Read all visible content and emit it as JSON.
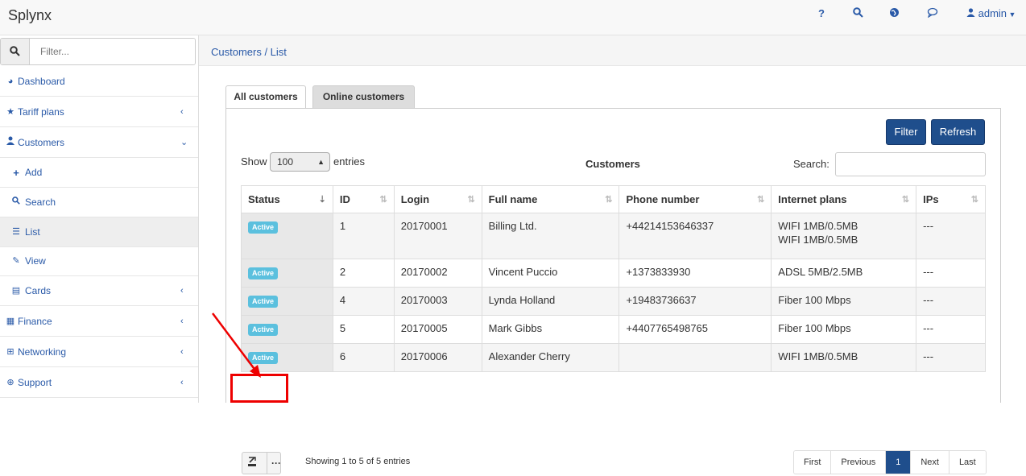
{
  "app": {
    "brand": "Splynx",
    "user_label": "admin"
  },
  "topbar_icons": [
    "help-icon",
    "search-icon",
    "globe-icon",
    "chat-icon",
    "user-icon"
  ],
  "topbar_help": "?",
  "sidebar": {
    "filter_placeholder": "Filter...",
    "items": [
      {
        "label": "Dashboard",
        "icon": "dashboard-icon"
      },
      {
        "label": "Tariff plans",
        "icon": "star-icon"
      },
      {
        "label": "Customers",
        "icon": "user-icon"
      },
      {
        "label": "Add",
        "icon": "plus-icon"
      },
      {
        "label": "Search",
        "icon": "search-icon"
      },
      {
        "label": "List",
        "icon": "list-icon"
      },
      {
        "label": "View",
        "icon": "pencil-icon"
      },
      {
        "label": "Cards",
        "icon": "cards-icon"
      },
      {
        "label": "Finance",
        "icon": "calculator-icon"
      },
      {
        "label": "Networking",
        "icon": "sitemap-icon"
      },
      {
        "label": "Support",
        "icon": "lifebuoy-icon"
      }
    ]
  },
  "breadcrumb": "Customers / List",
  "tabs": [
    "All customers",
    "Online customers"
  ],
  "buttons": {
    "filter": "Filter",
    "refresh": "Refresh"
  },
  "controls": {
    "show_label": "Show",
    "show_value": "100",
    "entries_label": "entries",
    "table_caption": "Customers",
    "search_label": "Search:"
  },
  "table": {
    "columns": [
      "Status",
      "ID",
      "Login",
      "Full name",
      "Phone number",
      "Internet plans",
      "IPs"
    ],
    "rows": [
      {
        "status": "Active",
        "id": "1",
        "login": "20170001",
        "name": "Billing Ltd.",
        "phone": "+44214153646337",
        "plans": "WIFI 1MB/0.5MB",
        "plans2": "WIFI 1MB/0.5MB",
        "ips": "---"
      },
      {
        "status": "Active",
        "id": "2",
        "login": "20170002",
        "name": "Vincent Puccio",
        "phone": "+1373833930",
        "plans": "ADSL 5MB/2.5MB",
        "plans2": "",
        "ips": "---"
      },
      {
        "status": "Active",
        "id": "4",
        "login": "20170003",
        "name": "Lynda Holland",
        "phone": "+19483736637",
        "plans": "Fiber 100 Mbps",
        "plans2": "",
        "ips": "---"
      },
      {
        "status": "Active",
        "id": "5",
        "login": "20170005",
        "name": "Mark Gibbs",
        "phone": "+4407765498765",
        "plans": "Fiber 100 Mbps",
        "plans2": "",
        "ips": "---"
      },
      {
        "status": "Active",
        "id": "6",
        "login": "20170006",
        "name": "Alexander Cherry",
        "phone": "",
        "plans": "WIFI 1MB/0.5MB",
        "plans2": "",
        "ips": "---"
      }
    ]
  },
  "footer": {
    "showing": "Showing 1 to 5 of 5 entries",
    "more": "···"
  },
  "pagination": [
    "First",
    "Previous",
    "1",
    "Next",
    "Last"
  ],
  "colors": {
    "accent": "#1f4e8c",
    "link": "#2a5aa8",
    "badge": "#5bc0de",
    "annotation": "#e00000"
  }
}
